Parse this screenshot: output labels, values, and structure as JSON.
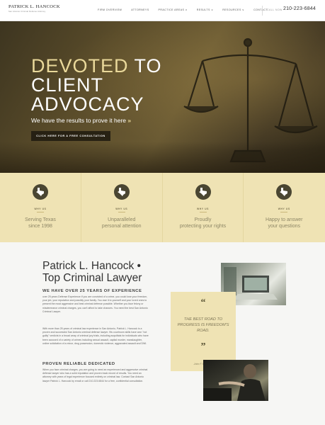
{
  "header": {
    "logo_name": "PATRICK L. HANCOCK",
    "logo_tagline": "San Antonio Criminal Defense Attorney",
    "nav": [
      {
        "label": "FIRM OVERVIEW"
      },
      {
        "label": "ATTORNEYS"
      },
      {
        "label": "PRACTICE AREAS ∨"
      },
      {
        "label": "RESULTS ∨"
      },
      {
        "label": "RESOURCES ∨"
      },
      {
        "label": "CONTACT"
      }
    ],
    "call_label": "CALL NOW",
    "phone": "210-223-6844"
  },
  "hero": {
    "title_accent": "DEVOTED",
    "title_rest1": " TO",
    "title_line2": "CLIENT",
    "title_line3": "ADVOCACY",
    "subtitle": "We have the results to prove it here",
    "subtitle_arrows": "»",
    "button_label": "CLICK HERE FOR A FREE CONSULTATION"
  },
  "features": [
    {
      "icon": "texas-icon",
      "why": "WHY US",
      "line1": "Serving Texas",
      "line2": "since 1998"
    },
    {
      "icon": "texas-icon",
      "why": "WHY US",
      "line1": "Unparalleled",
      "line2": "personal attention"
    },
    {
      "icon": "texas-icon",
      "why": "WHY US",
      "line1": "Proudly",
      "line2": "protecting your rights"
    },
    {
      "icon": "texas-icon",
      "why": "WHY US",
      "line1": "Happy to answer",
      "line2": "your questions"
    }
  ],
  "content": {
    "title_line1": "Patrick L. Hancock •",
    "title_line2": "Top Criminal Lawyer",
    "heading1": "WE HAVE OVER 25 YEARS OF EXPERIENCE",
    "para1": "over 25 years Defense Experience If you are convicted of a crime, you could lose your freedom, your job, your reputation and possibly your family. You owe it to yourself and your loved ones to present the most aggressive and best criminal defense possible. Whether you face felony or misdemeanor criminal charges, you can't afford to take chances. You need the best San Antonio Criminal Lawyer.",
    "para2": "With more than 25 years of criminal law experience in San Antonio, Patrick L. Hancock is a proven and successful San Antonio criminal defense lawyer. His courtroom skills have won \"not guilty\" verdicts in a broad array of criminal jury trials, including acquittals for individuals who have been accused of a variety of crimes including sexual assault, capital murder, manslaughter, online solicitation of a minor, drug possession, domestic violence, aggravated assault and DWI.",
    "heading2": "PROVEN RELIABLE DEDICATED",
    "para3": "When you face criminal charges, you are going to need an experienced and aggressive criminal defense lawyer who has a solid reputation and proven track record of results. You need an attorney with years of legal experience focused entirely on criminal law. Contact San Antonio lawyer Patrick L. Hancock by email or call 210.223.6844 for a free, confidential consultation."
  },
  "quote": {
    "open": "“",
    "text": "THE BEST ROAD TO PROGRESS IS FREEDOM'S ROAD.",
    "close": "”",
    "author": "John F. Kennedy"
  },
  "colors": {
    "accent": "#e9d89a",
    "band": "#efe3b4",
    "icon_bg": "#4a4632"
  }
}
